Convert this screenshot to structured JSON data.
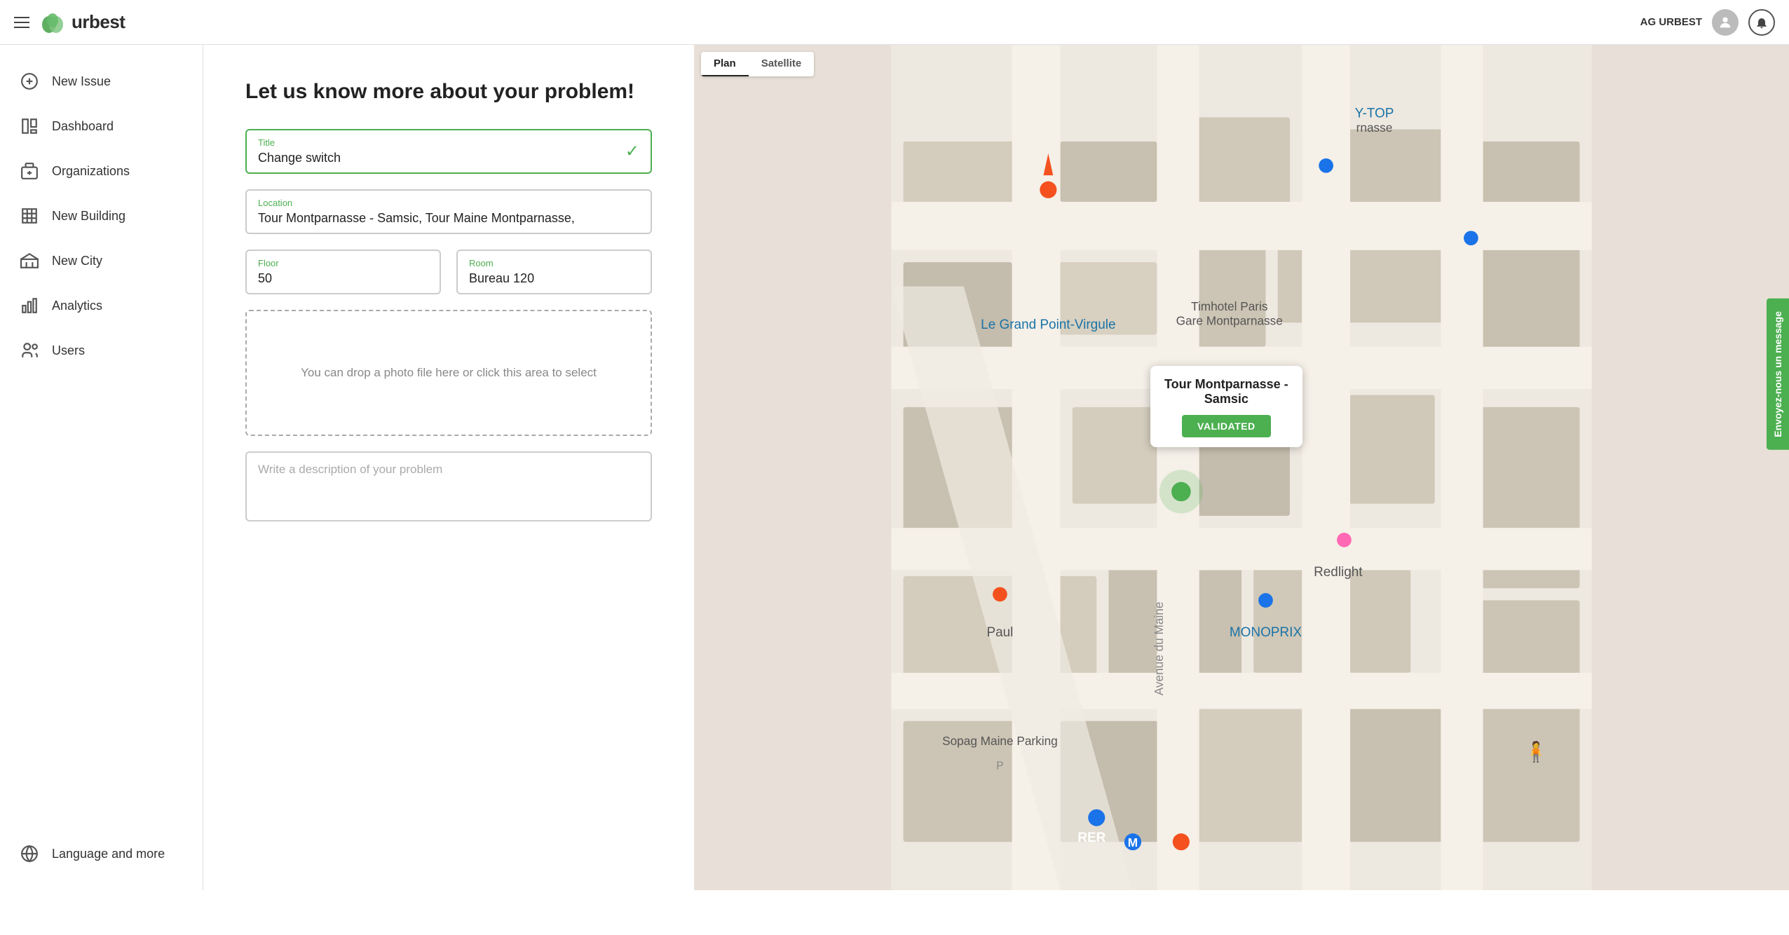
{
  "header": {
    "hamburger_label": "menu",
    "logo_text": "urbest",
    "username": "AG URBEST"
  },
  "sidebar": {
    "items": [
      {
        "id": "new-issue",
        "label": "New Issue",
        "icon": "plus-circle"
      },
      {
        "id": "dashboard",
        "label": "Dashboard",
        "icon": "dashboard"
      },
      {
        "id": "organizations",
        "label": "Organizations",
        "icon": "organizations"
      },
      {
        "id": "new-building",
        "label": "New Building",
        "icon": "building"
      },
      {
        "id": "new-city",
        "label": "New City",
        "icon": "city"
      },
      {
        "id": "analytics",
        "label": "Analytics",
        "icon": "analytics"
      },
      {
        "id": "users",
        "label": "Users",
        "icon": "users"
      }
    ],
    "bottom_items": [
      {
        "id": "language",
        "label": "Language and more",
        "icon": "globe"
      }
    ]
  },
  "form": {
    "heading": "Let us know more about your problem!",
    "title_label": "Title",
    "title_value": "Change switch",
    "location_label": "Location",
    "location_value": "Tour Montparnasse - Samsic, Tour Maine Montparnasse,",
    "floor_label": "Floor",
    "floor_value": "50",
    "room_label": "Room",
    "room_value": "Bureau 120",
    "dropzone_text": "You can drop a photo file here or click this area to select",
    "description_placeholder": "Write a description of your problem"
  },
  "map": {
    "tab_plan": "Plan",
    "tab_satellite": "Satellite",
    "card_title": "Tour Montparnasse -\nSamsic",
    "card_button": "VALIDATED",
    "jivochat_label": "Envoyez-nous un message",
    "map_label_1": "Le Grand Point-Virgule",
    "map_label_2": "Timhotel Paris\nGare Montparnasse",
    "map_label_3": "Tour Montparnasse - Samsic",
    "map_label_4": "MONOPRIX",
    "map_label_5": "Redlight",
    "map_label_6": "Y-TOP\nrnasse"
  },
  "colors": {
    "green": "#4caf50",
    "sidebar_border": "#e0e0e0",
    "field_border_active": "#4caf50",
    "field_border_normal": "#cccccc"
  }
}
